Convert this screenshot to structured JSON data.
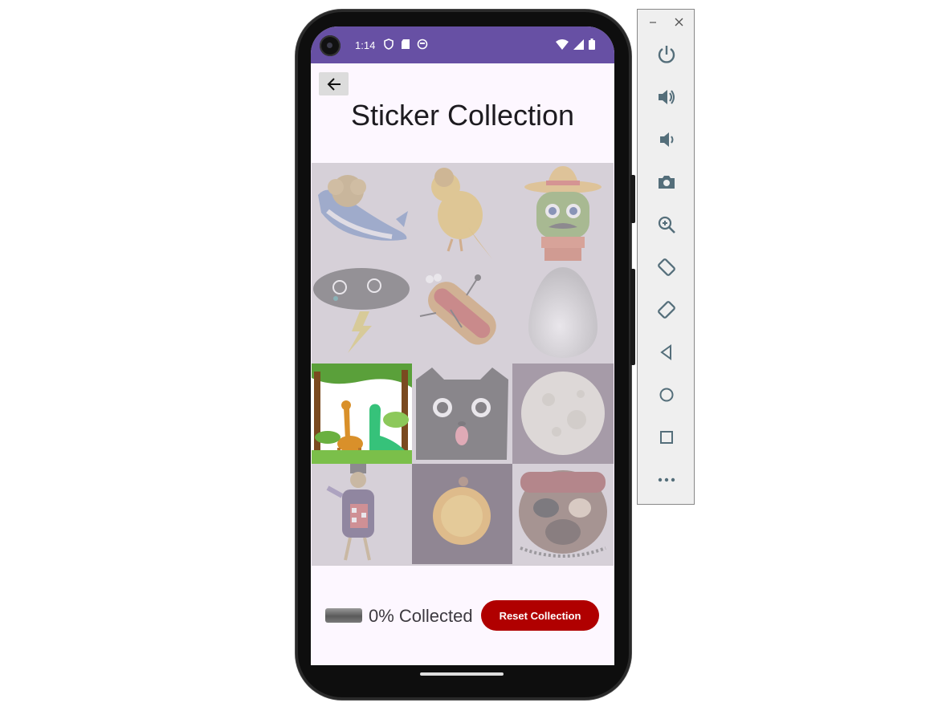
{
  "status_bar": {
    "time": "1:14"
  },
  "app": {
    "title": "Sticker Collection",
    "progress_percent": 0,
    "collected_label": "0% Collected",
    "reset_label": "Reset Collection"
  },
  "stickers": [
    {
      "name": "whale-sticker",
      "collected": false
    },
    {
      "name": "bird-sticker",
      "collected": false
    },
    {
      "name": "cactus-sombrero-sticker",
      "collected": false
    },
    {
      "name": "storm-cloud-sticker",
      "collected": false
    },
    {
      "name": "hotdog-sticker",
      "collected": false
    },
    {
      "name": "egg-sticker",
      "collected": false
    },
    {
      "name": "giraffe-dino-sticker",
      "collected": true
    },
    {
      "name": "cat-sticker",
      "collected": false
    },
    {
      "name": "moon-sticker",
      "collected": false
    },
    {
      "name": "bird-magician-sticker",
      "collected": false
    },
    {
      "name": "sun-planet-sticker",
      "collected": false
    },
    {
      "name": "pug-pirate-sticker",
      "collected": false
    }
  ],
  "emulator": {
    "buttons": [
      "power-icon",
      "volume-up-icon",
      "volume-down-icon",
      "camera-icon",
      "zoom-icon",
      "rotate-left-icon",
      "rotate-right-icon",
      "back-icon",
      "home-icon",
      "overview-icon",
      "more-icon"
    ],
    "accent": "#546e7a"
  },
  "colors": {
    "status_bar": "#6750a4",
    "reset_button": "#b00000",
    "screen_bg": "#fdf7ff"
  }
}
